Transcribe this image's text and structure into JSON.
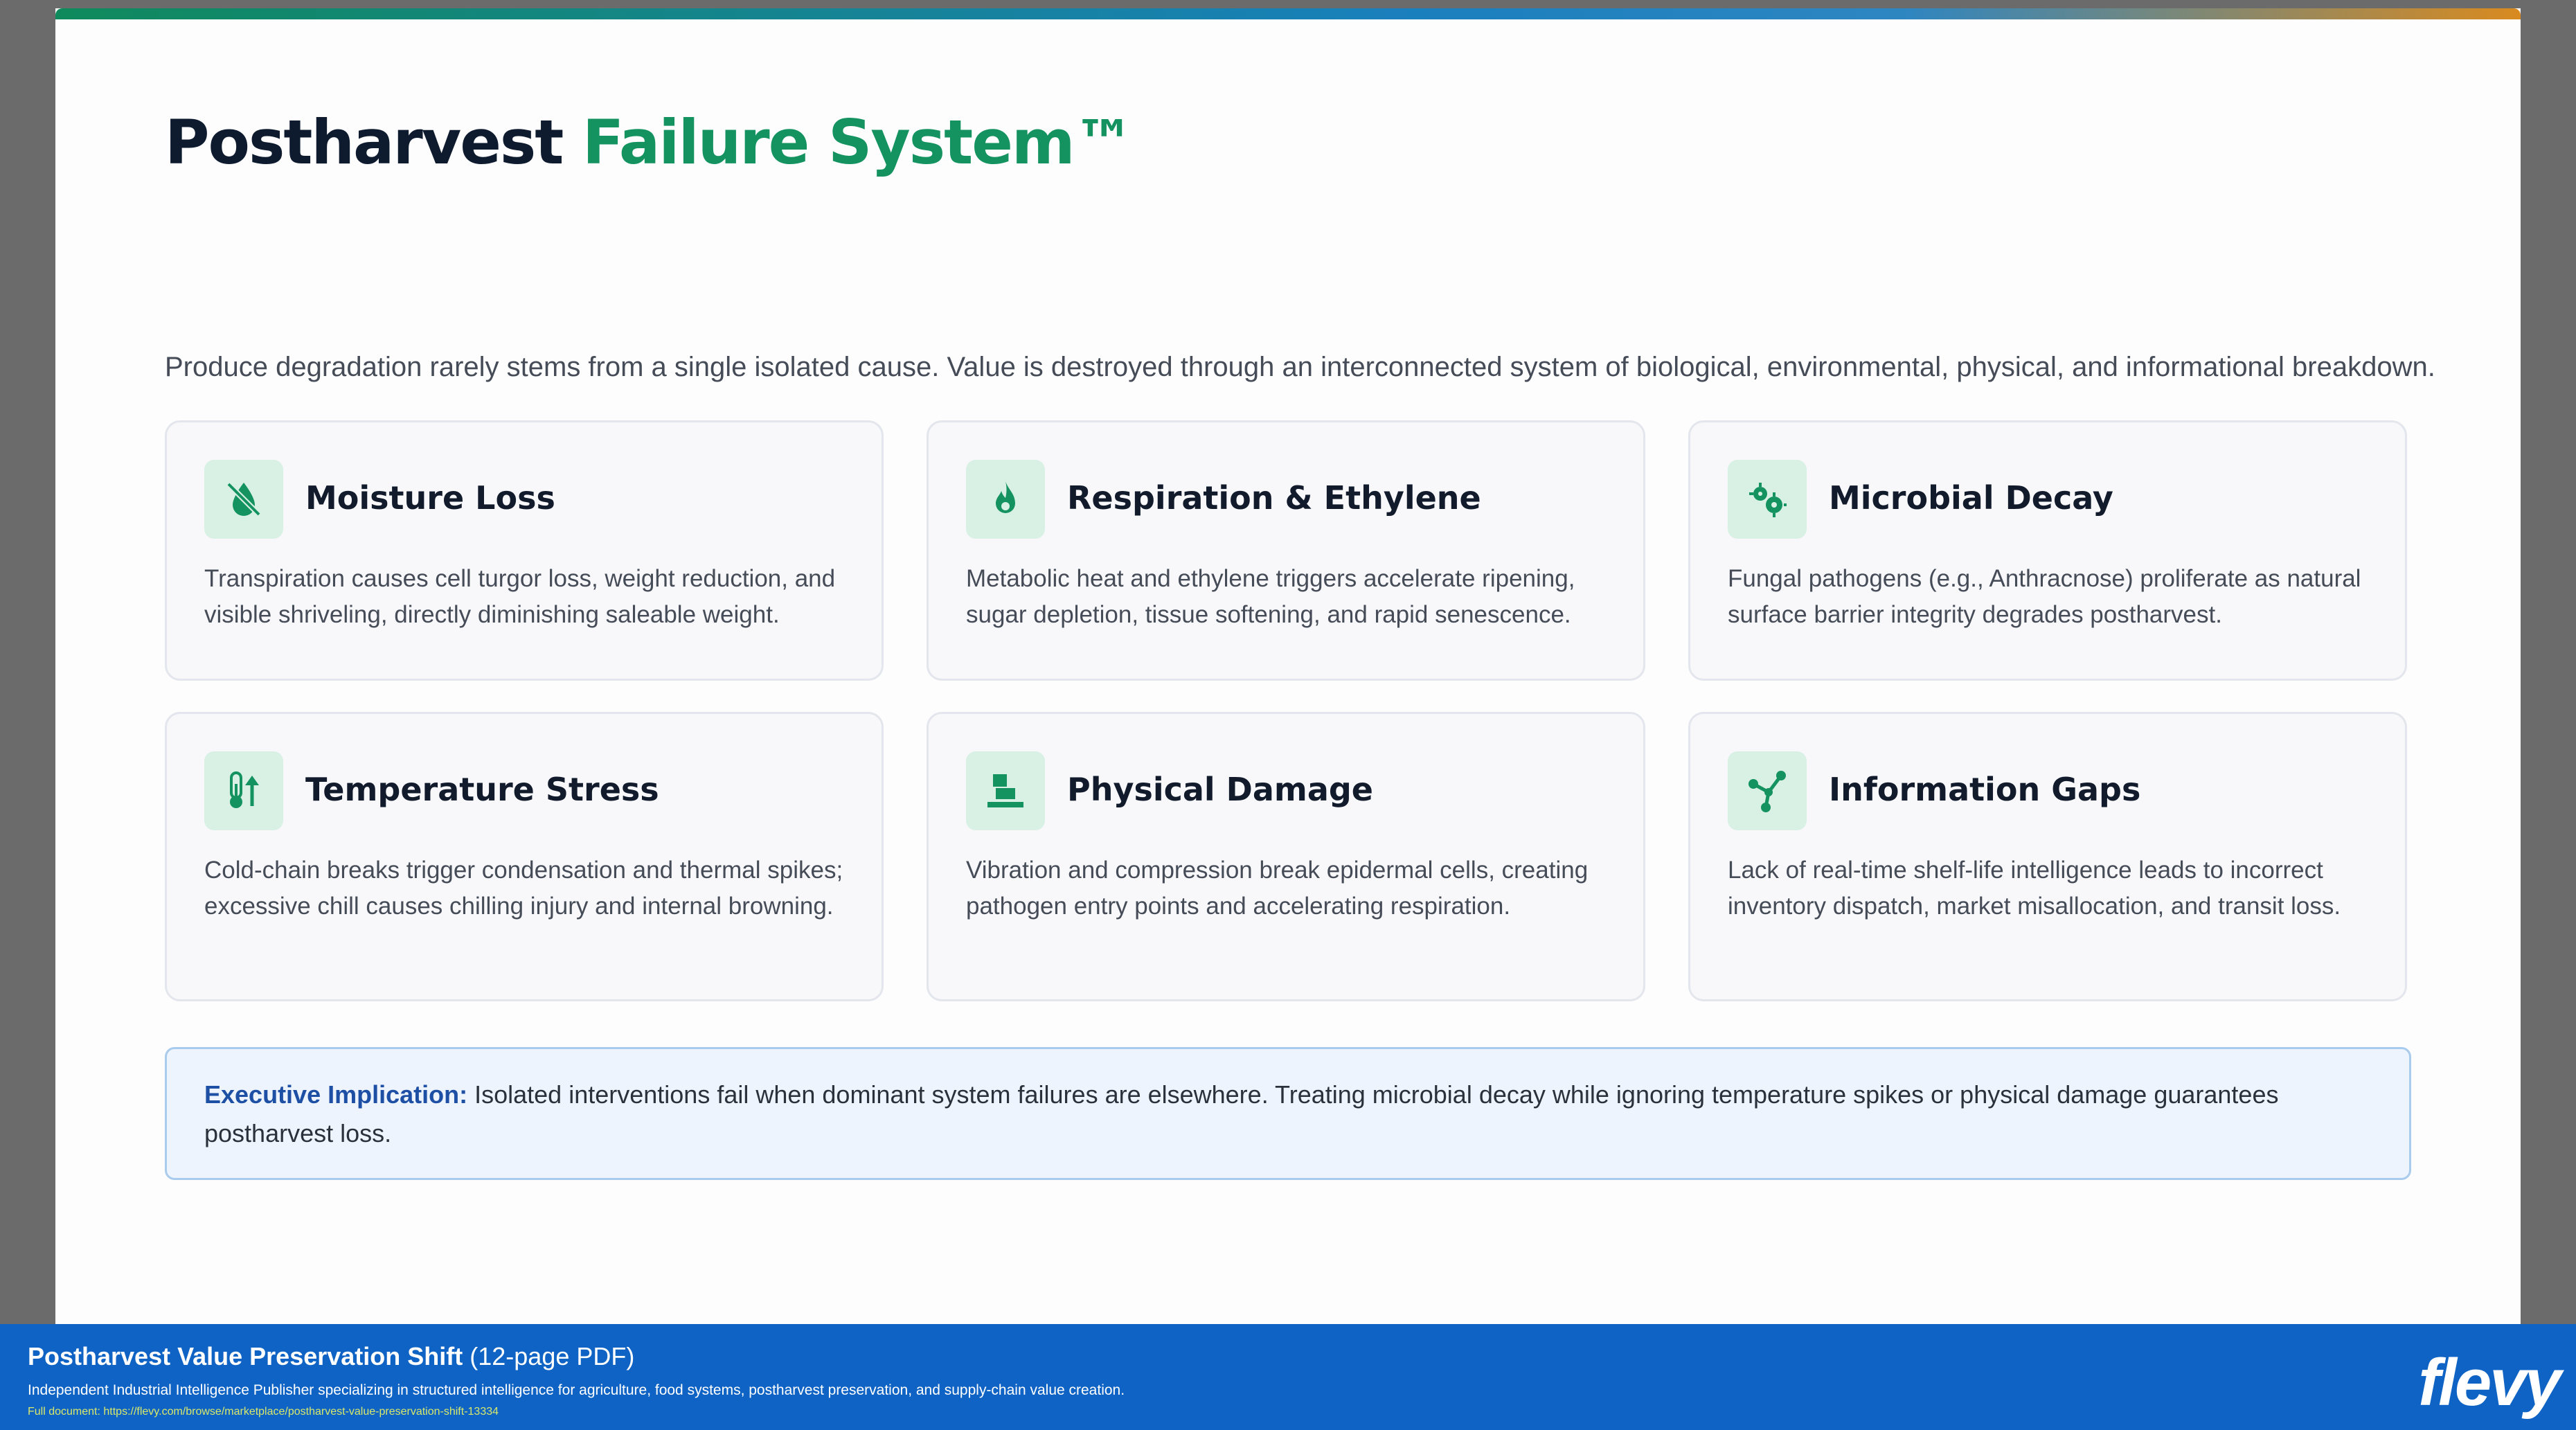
{
  "slide": {
    "title_main": "Postharvest",
    "title_accent": "Failure System™",
    "subtitle": "Produce degradation rarely stems from a single isolated cause. Value is destroyed through an interconnected system of biological, environmental, physical, and informational breakdown."
  },
  "cards": [
    {
      "icon": "moisture-off-icon",
      "title": "Moisture Loss",
      "text": "Transpiration causes cell turgor loss, weight reduction, and visible shriveling, directly diminishing saleable weight."
    },
    {
      "icon": "flame-icon",
      "title": "Respiration & Ethylene",
      "text": "Metabolic heat and ethylene triggers accelerate ripening, sugar depletion, tissue softening, and rapid senescence."
    },
    {
      "icon": "bacteria-icon",
      "title": "Microbial Decay",
      "text": "Fungal pathogens (e.g., Anthracnose) proliferate as natural surface barrier integrity degrades postharvest."
    },
    {
      "icon": "thermometer-icon",
      "title": "Temperature Stress",
      "text": "Cold-chain breaks trigger condensation and thermal spikes; excessive chill causes chilling injury and internal browning."
    },
    {
      "icon": "boxes-icon",
      "title": "Physical Damage",
      "text": "Vibration and compression break epidermal cells, creating pathogen entry points and accelerating respiration."
    },
    {
      "icon": "network-icon",
      "title": "Information Gaps",
      "text": "Lack of real-time shelf-life intelligence leads to incorrect inventory dispatch, market misallocation, and transit loss."
    }
  ],
  "executive": {
    "label": "Executive Implication:",
    "text": " Isolated interventions fail when dominant system failures are elsewhere. Treating microbial decay while ignoring temperature spikes or physical damage guarantees postharvest loss."
  },
  "footer": {
    "title": "Postharvest Value Preservation Shift",
    "pages": " (12-page PDF)",
    "description": "Independent Industrial Intelligence Publisher specializing in structured intelligence for agriculture, food systems, postharvest preservation, and supply-chain value creation.",
    "url": "Full document: https://flevy.com/browse/marketplace/postharvest-value-preservation-shift-13334",
    "logo": "flevy"
  },
  "colors": {
    "accent_green": "#149360",
    "icon_bg": "#d9f1e4",
    "footer_blue": "#0f63c4",
    "exec_label": "#1d4fa5"
  }
}
